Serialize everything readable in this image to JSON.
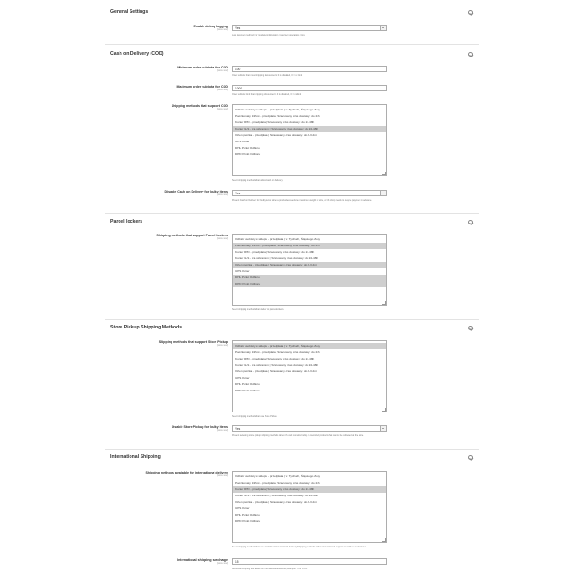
{
  "sections": {
    "general": {
      "title": "General Settings",
      "debug_label": "Enable debug logging",
      "debug_scope": "[store view]",
      "debug_value": "Yes",
      "debug_note": "Logs payment method / for module configuration / payment operations / log."
    },
    "cod": {
      "title": "Cash on Delivery (COD)",
      "min_label": "Minimum order subtotal for COD",
      "min_scope": "[store view]",
      "min_value": "100",
      "min_note": "Order subtotal that must shipping discounted to 0 is disabled, 0 = no limit",
      "max_label": "Maximum order subtotal for COD",
      "max_scope": "[store view]",
      "max_value": "1000",
      "max_note": "Order subtotal limit that shipping discounted to 0 is disabled, 0 = no limit",
      "methods_label": "Shipping methods that support COD",
      "methods_scope": "[store view]",
      "methods_note": "Select shipping methods that allow Cash on Delivery.",
      "bulky_label": "Disable Cash on Delivery for bulky items",
      "bulky_scope": "[store view]",
      "bulky_value": "Yes",
      "bulky_note": "Prevent Cash on Delivery for bulky items when a product exceeds the maximum weight or size, or the shop needs to require payment in advance."
    },
    "parcel": {
      "title": "Parcel lockers",
      "methods_label": "Shipping methods that support Parcel lockers",
      "methods_scope": "[store view]",
      "methods_note": "Select shipping methods that deliver to parcel lockers."
    },
    "pickup": {
      "title": "Store Pickup Shipping Methods",
      "methods_label": "Shipping methods that support Store Pickup",
      "methods_scope": "[store view]",
      "methods_note": "Select shipping methods that use Store Pickup.",
      "bulky_label": "Disable Store Pickup for bulky items",
      "bulky_scope": "[store view]",
      "bulky_value": "Yes",
      "bulky_note": "Prevent selecting store pickup shipping methods when the cart contains bulky or oversized products that cannot be collected at the store."
    },
    "intl": {
      "title": "International Shipping",
      "methods_label": "Shipping methods available for international delivery",
      "methods_scope": "[store view]",
      "methods_note": "Select shipping methods that are available for international delivery. Shipping methods without international support are hidden at checkout.",
      "surcharge_label": "International shipping surcharge",
      "surcharge_scope": "[store view]",
      "surcharge_value": "15",
      "surcharge_note": "Additional shipping fee added for international deliveries, example: 15 or 15%."
    }
  },
  "shipping_options": [
    "Odbiór osobisty w sklepie - przedpłata | w: Tychach, Śląskiego Zoby",
    "Paczkomaty InPost - przedpłata | Szacowany czas dostawy: do 24h",
    "Kurier DPD - przedpłata | Szacowany czas dostawy: do 24-48h",
    "Kurier GLS - za pobraniem | Szacowany czas dostawy: do 24-48h",
    "Orlen paczka - przedpłata | Szacowany czas dostawy: do 2-3 dni",
    "UPS Kurier",
    "DHL Punkt Odbioru",
    "DPD Punkt Odbioru"
  ],
  "selections": {
    "cod": [
      3
    ],
    "parcel": [
      1,
      4,
      6,
      7
    ],
    "pickup": [
      0
    ],
    "intl": [
      2
    ]
  }
}
